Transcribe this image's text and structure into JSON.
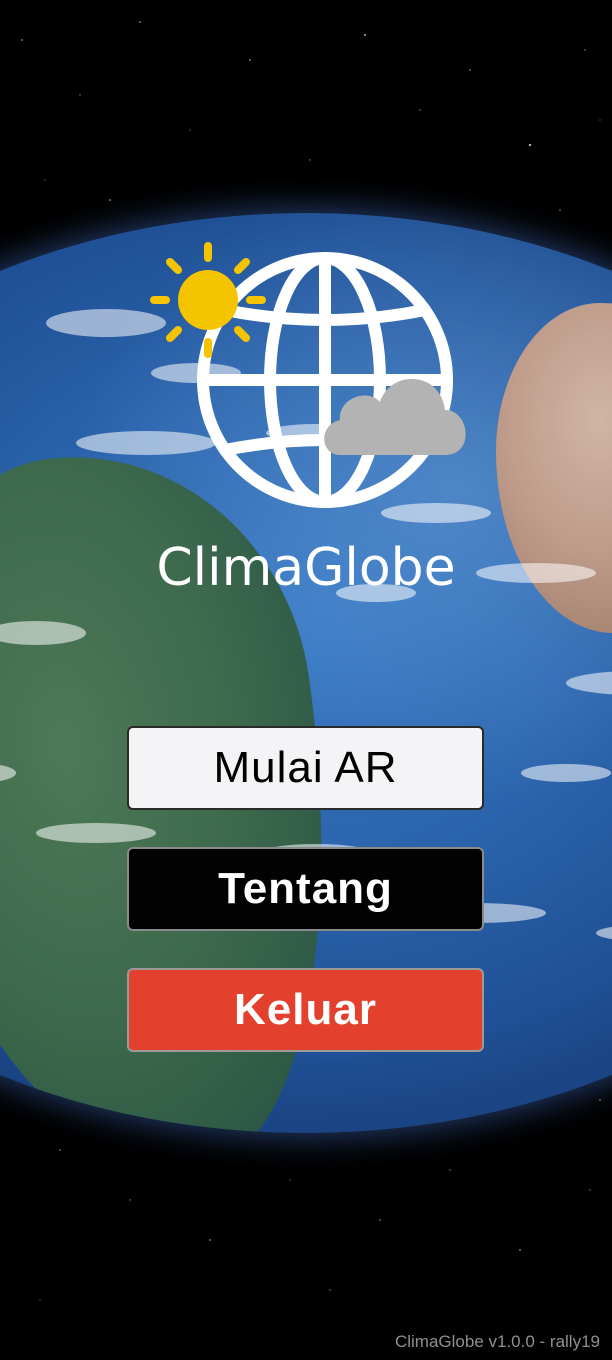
{
  "app": {
    "name": "ClimaGlobe",
    "logo_icon": "globe-sun-cloud-icon",
    "colors": {
      "sun": "#f5c400",
      "cloud": "#b3b3b3",
      "globe_lines": "#ffffff",
      "background": "#000000"
    }
  },
  "menu": {
    "start_label": "Mulai AR",
    "about_label": "Tentang",
    "exit_label": "Keluar",
    "colors": {
      "start_bg": "#f4f4f6",
      "about_bg": "#020202",
      "exit_bg": "#e3402d"
    }
  },
  "footer": {
    "version": "ClimaGlobe v1.0.0 - rally19"
  }
}
